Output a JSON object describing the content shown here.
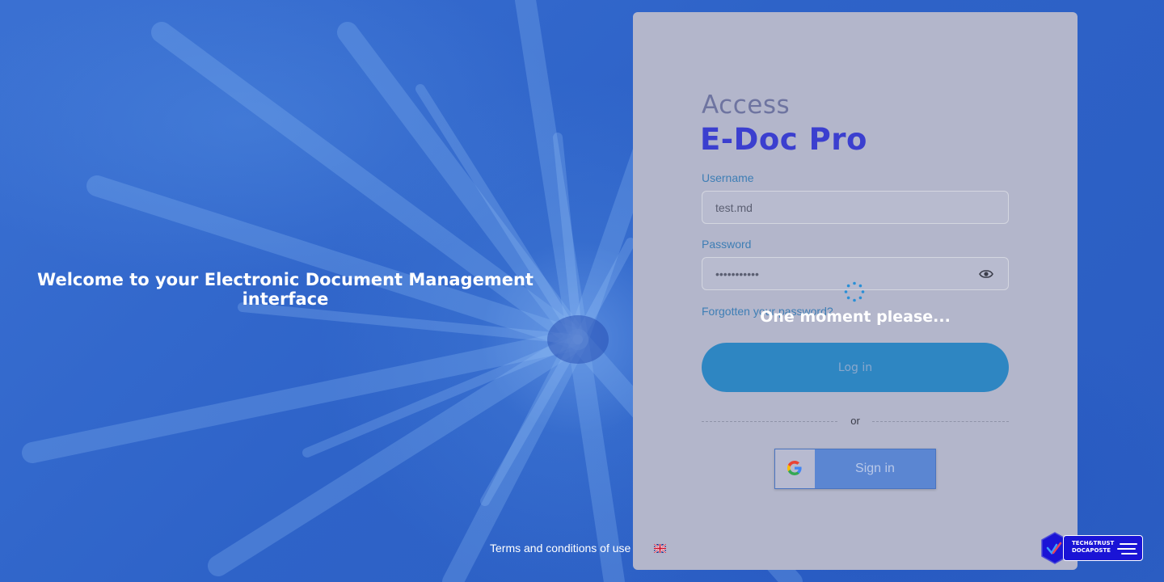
{
  "welcome": {
    "text": "Welcome to your Electronic Document Management interface"
  },
  "footer": {
    "terms": "Terms and conditions of use",
    "language": "English"
  },
  "login": {
    "heading": "Access",
    "product": "E-Doc Pro",
    "username_label": "Username",
    "username_value": "test.md",
    "password_label": "Password",
    "password_value": "•••••••••••",
    "forgot": "Forgotten your password?",
    "loading_text": "One moment please...",
    "login_button": "Log in",
    "or": "or",
    "google_button": "Sign in"
  },
  "brand": {
    "line1": "TECH&TRUST",
    "line2": "DOCAPOSTE"
  },
  "colors": {
    "accent": "#3b3fcf",
    "button": "#2e86c2",
    "panel": "#b3b6cb",
    "background": "#2f64c9"
  }
}
